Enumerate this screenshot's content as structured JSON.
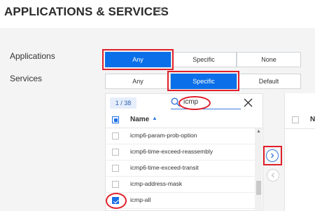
{
  "page": {
    "title": "APPLICATIONS & SERVICES"
  },
  "applications": {
    "label": "Applications",
    "options": [
      "Any",
      "Specific",
      "None"
    ],
    "selected": "Any"
  },
  "services": {
    "label": "Services",
    "options": [
      "Any",
      "Specific",
      "Default"
    ],
    "selected": "Specific"
  },
  "picker": {
    "count": "1 / 38",
    "search_value": "icmp",
    "column_name": "Name",
    "items": [
      {
        "label": "icmp6-param-prob-option",
        "checked": false
      },
      {
        "label": "icmp6-time-exceed-reassembly",
        "checked": false
      },
      {
        "label": "icmp6-time-exceed-transit",
        "checked": false
      },
      {
        "label": "icmp-address-mask",
        "checked": false
      },
      {
        "label": "icmp-all",
        "checked": true
      }
    ]
  },
  "selected_panel": {
    "column_name": "N"
  },
  "colors": {
    "accent": "#0a6fe8",
    "highlight": "#e0202a"
  }
}
